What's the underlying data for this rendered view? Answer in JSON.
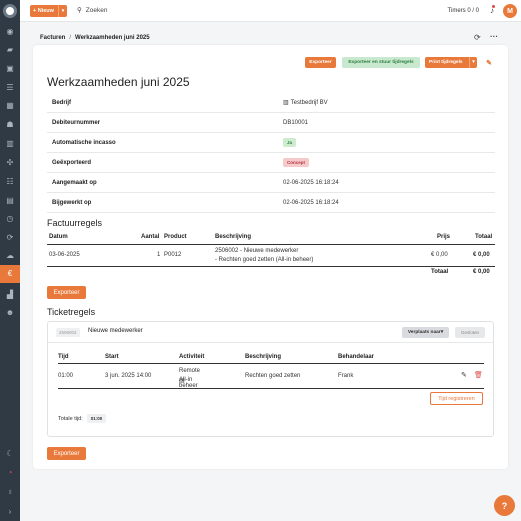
{
  "topbar": {
    "new_label": "+ Nieuw",
    "search_label": "Zoeken",
    "timers_label": "Timers 0 / 0",
    "avatar_initial": "M"
  },
  "breadcrumb": {
    "parent": "Facturen",
    "separator": "/",
    "current": "Werkzaamheden juni 2025"
  },
  "actions": {
    "export": "Exporteer",
    "export_send": "Exporteer en stuur tijdregels",
    "print": "Print tijdregels"
  },
  "invoice": {
    "title": "Werkzaamheden juni 2025",
    "details": [
      {
        "label": "Bedrijf",
        "value": "Testbedrijf BV"
      },
      {
        "label": "Debiteurnummer",
        "value": "DB10001"
      },
      {
        "label": "Automatische incasso",
        "value": "Ja"
      },
      {
        "label": "Geëxporteerd",
        "value": "Concept"
      },
      {
        "label": "Aangemaakt op",
        "value": "02-06-2025 16:18:24"
      },
      {
        "label": "Bijgewerkt op",
        "value": "02-06-2025 16:18:24"
      }
    ]
  },
  "invoice_lines": {
    "title": "Factuurregels",
    "columns": {
      "date": "Datum",
      "qty": "Aantal",
      "product": "Product",
      "description": "Beschrijving",
      "price": "Prijs",
      "total": "Totaal"
    },
    "rows": [
      {
        "date": "03-06-2025",
        "qty": "1",
        "product": "P0012",
        "desc1": "2506002 - Nieuwe medewerker",
        "desc2": "- Rechten goed zetten (All-in beheer)",
        "price": "€ 0,00",
        "total": "€ 0,00"
      }
    ],
    "total_label": "Totaal",
    "total_value": "€ 0,00",
    "export_button": "Exporteer"
  },
  "ticket_lines": {
    "title": "Ticketregels",
    "ticket_id": "2506002",
    "ticket_name": "Nieuwe medewerker",
    "move_button": "Verplaats naar",
    "close_button": "Gesloten",
    "columns": {
      "time": "Tijd",
      "start": "Start",
      "activity": "Activiteit",
      "description": "Beschrijving",
      "handler": "Behandelaar"
    },
    "rows": [
      {
        "time": "01:00",
        "start": "3 jun. 2025 14:00",
        "activity1": "Remote",
        "activity2": "All-in beheer",
        "description": "Rechten goed zetten",
        "handler": "Frank"
      }
    ],
    "register_button": "Tijd registreren",
    "total_time_label": "Totale tijd:",
    "total_time_value": "01:00",
    "export_button": "Exporteer"
  },
  "help_label": "?",
  "colors": {
    "accent": "#e8793a",
    "sidebar": "#2f3a45",
    "success": "#2e7d3e",
    "danger": "#b23a40"
  }
}
